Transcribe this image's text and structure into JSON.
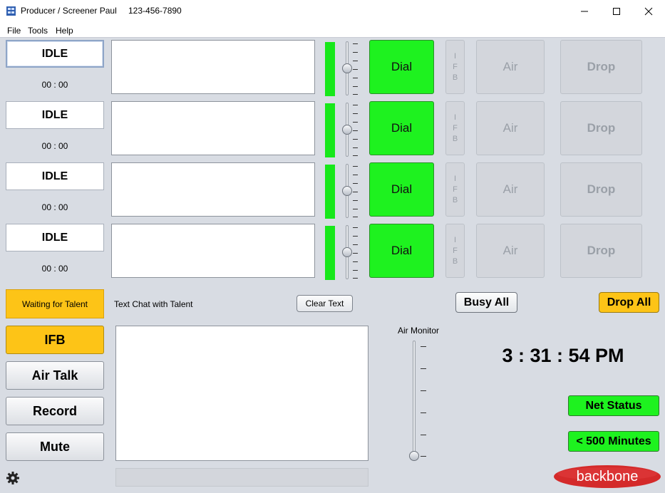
{
  "window": {
    "title": "Producer / Screener Paul",
    "phone": "123-456-7890"
  },
  "menu": {
    "file": "File",
    "tools": "Tools",
    "help": "Help"
  },
  "lines": [
    {
      "status": "IDLE",
      "timer": "00 : 00",
      "dial": "Dial",
      "ifb": [
        "I",
        "F",
        "B"
      ],
      "air": "Air",
      "drop": "Drop"
    },
    {
      "status": "IDLE",
      "timer": "00 : 00",
      "dial": "Dial",
      "ifb": [
        "I",
        "F",
        "B"
      ],
      "air": "Air",
      "drop": "Drop"
    },
    {
      "status": "IDLE",
      "timer": "00 : 00",
      "dial": "Dial",
      "ifb": [
        "I",
        "F",
        "B"
      ],
      "air": "Air",
      "drop": "Drop"
    },
    {
      "status": "IDLE",
      "timer": "00 : 00",
      "dial": "Dial",
      "ifb": [
        "I",
        "F",
        "B"
      ],
      "air": "Air",
      "drop": "Drop"
    }
  ],
  "talent": {
    "waiting": "Waiting for Talent",
    "chat_label": "Text Chat with Talent",
    "clear_text": "Clear Text"
  },
  "actions": {
    "busy_all": "Busy All",
    "drop_all": "Drop All"
  },
  "side_buttons": {
    "ifb": "IFB",
    "air_talk": "Air Talk",
    "record": "Record",
    "mute": "Mute"
  },
  "air_monitor": {
    "label": "Air Monitor"
  },
  "clock": "3 : 31 : 54 PM",
  "status": {
    "net": "Net Status",
    "minutes": "< 500 Minutes"
  },
  "logo": "backbone",
  "icons": {
    "app": "app-icon",
    "gear": "gear-icon",
    "minimize": "minimize-icon",
    "maximize": "maximize-icon",
    "close": "close-icon"
  },
  "colors": {
    "green": "#1ef21f",
    "yellow": "#fdc417",
    "logo_red": "#d42a2a"
  }
}
